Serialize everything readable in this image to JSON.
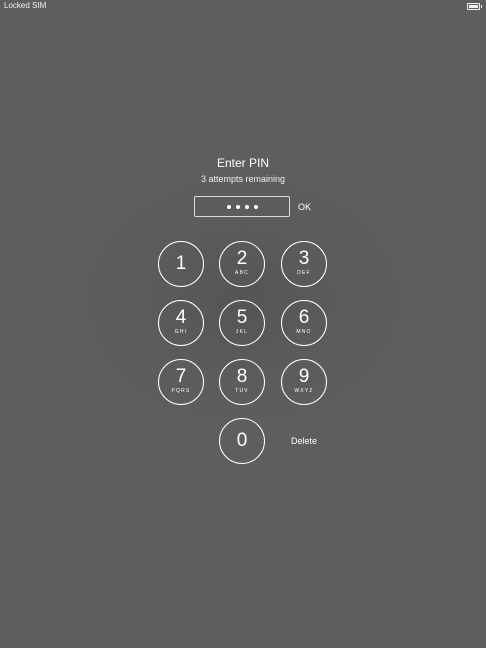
{
  "status_bar": {
    "carrier": "Locked SIM"
  },
  "prompt": {
    "title": "Enter PIN",
    "subtitle": "3 attempts remaining",
    "entered_digit_count": 4,
    "ok_label": "OK"
  },
  "keypad": {
    "keys": [
      {
        "digit": "1",
        "letters": ""
      },
      {
        "digit": "2",
        "letters": "ABC"
      },
      {
        "digit": "3",
        "letters": "DEF"
      },
      {
        "digit": "4",
        "letters": "GHI"
      },
      {
        "digit": "5",
        "letters": "JKL"
      },
      {
        "digit": "6",
        "letters": "MNO"
      },
      {
        "digit": "7",
        "letters": "PQRS"
      },
      {
        "digit": "8",
        "letters": "TUV"
      },
      {
        "digit": "9",
        "letters": "WXYZ"
      },
      {
        "digit": "0",
        "letters": ""
      }
    ],
    "delete_label": "Delete"
  },
  "colors": {
    "background": "#5e5e5e",
    "foreground": "#ffffff"
  },
  "icons": {
    "battery": "battery-icon",
    "pin_dot": "pin-dot-icon"
  }
}
